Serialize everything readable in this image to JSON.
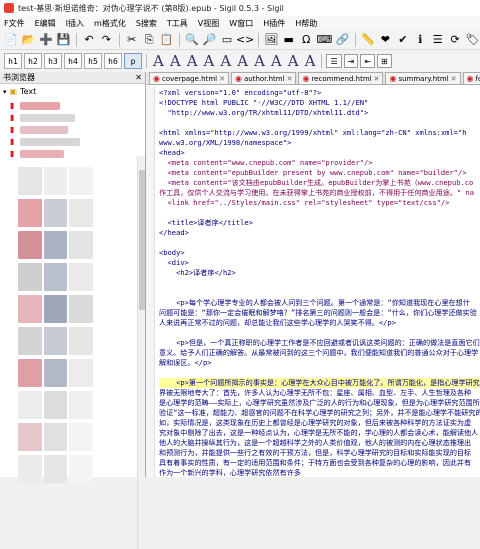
{
  "titlebar": {
    "title": "test-基思·斯坦诺维奇：对伪心理学说不 (第8版).epub - Sigil 0.5.3 - Sigil"
  },
  "menu": [
    "F文件",
    "E编辑",
    "I插入",
    "m格式化",
    "S搜索",
    "T工具",
    "V视图",
    "W窗口",
    "H插件",
    "H帮助"
  ],
  "toolbar2": {
    "headings": [
      "h1",
      "h2",
      "h3",
      "h4",
      "h5",
      "h6",
      "p"
    ],
    "align_label": "A"
  },
  "left_panel": {
    "title": "书浏览器",
    "root": "Text"
  },
  "tabs": [
    "coverpage.html",
    "author.html",
    "recommend.html",
    "summary.html",
    "fo"
  ],
  "code_lines": [
    "<?xml version=\"1.0\" encoding=\"utf-8\"?>",
    "<!DOCTYPE html PUBLIC \"-//W3C//DTD XHTML 1.1//EN\"",
    "  \"http://www.w3.org/TR/xhtml11/DTD/xhtml11.dtd\">",
    "",
    "<html xmlns=\"http://www.w3.org/1999/xhtml\" xml:lang=\"zh-CN\" xmlns:xml=\"h",
    "www.w3.org/XML/1998/namespace\">",
    "<head>",
    "  <meta content=\"www.cnepub.com\" name=\"provider\"/>",
    "  <meta content=\"epubBuilder present by www.cnepub.com\" name=\"builder\"/>",
    "  <meta content=\"该文档由epubBuilder生成。epubBuilder为掌上书苑（www.cnepub.co",
    "作工具，仅供个人交流与学习使用。在未获得掌上书苑的商业授权前，不得用于任何商业用途。\" na",
    "  <link href=\"../Styles/main.css\" rel=\"stylesheet\" type=\"text/css\"/>",
    "",
    "  <title>译者序</title>",
    "</head>",
    "",
    "<body>",
    "  <div>",
    "    <h2>译者序</h2>",
    "",
    "",
    "    <p>每个学心理学专业的人都会被人问到三个问题。第一个通常是：“你知道我现在心里在想什",
    "问题可能是：“那你一定会催眠和解梦咯？”排名第三的问题则一般会是：“什么，你们心理学还做实验",
    "人来说再正常不过的问题，却总能让我们这些学心理学的人哭笑不得。</p>",
    "",
    "    <p>但是，一个真正称职的心理学工作者是不应回避或者讥讽这类问题的：正确的做法是直面它们，",
    "意义。给予人们正确的解答。从最常被问到的这三个问题中，我们便能知道我们的普通公众对于心理学",
    "解和误区。</p>",
    "",
    "    <p>第一个问题所揭示的事实是：心理学在大众心目中被万能化了。所谓万能化，是指心理学研究",
    "界被无限地夸大了：首先，许多人认为心理学无所不包：星座、属相、血型、左手、人生哲理及各种",
    "是心理学的范畴——实际上，心理学研究虽然涉及广泛的人的行为和心理现象，但是为心理学研究范围所",
    "验证“这一标准，超能力、超感官的问题不在科学心理学的研究之列；另外，并不是能心理学不能研究的",
    "如，实际情况是，这类现象在历史上都曾经是心理学研究的对象，但后来被各种科学的方法证实为虚",
    "究对象中剔除了出去，这是一种经点认为，心理学是无所不能的，学心理的人都会读心术，能解读他人",
    "他人的大脑并操纵其行为，这是一个超越科学之外的人类价值观，他人的被测的内在心理状态推理出",
    "和预测行为，并能提供一些行之有效的干预方法，但是，科学心理学研究的目标和实际能实现的目标",
    "具有着事实的性质，有一定的适用范围和条件；于特方面也会受到各种复杂的心理的影响，因此并有",
    "作为一个新兴的学科，心理学研究依然有许多"
  ]
}
